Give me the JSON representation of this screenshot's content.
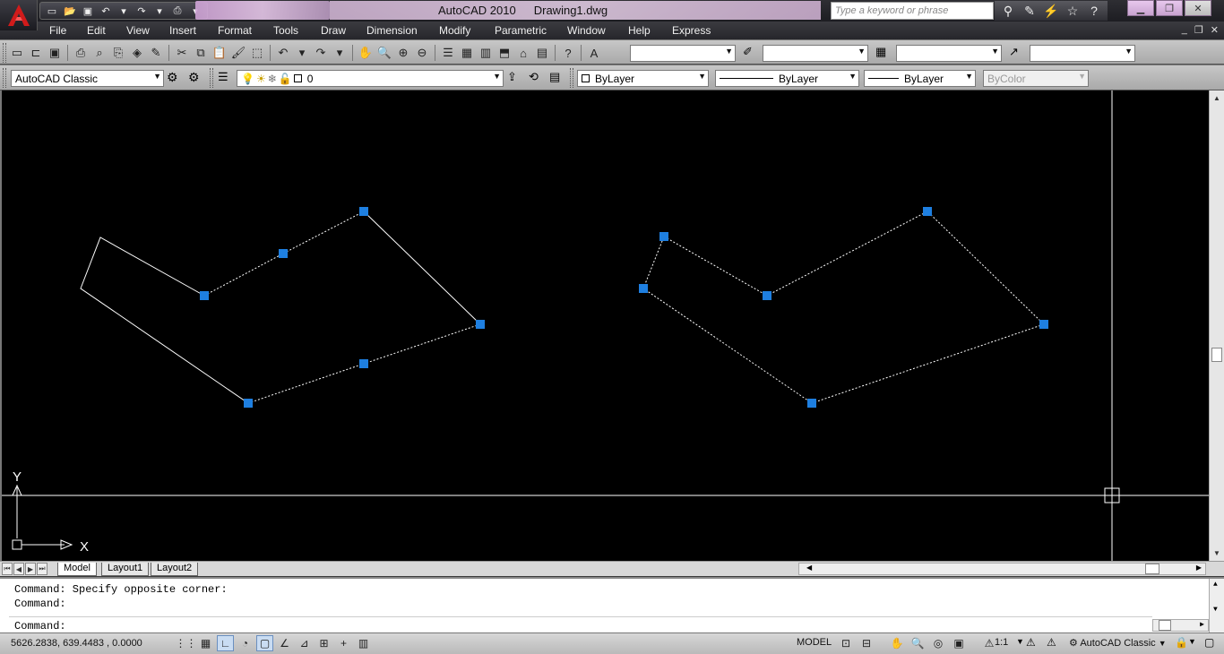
{
  "titlebar": {
    "app_name": "AutoCAD 2010",
    "file_name": "Drawing1.dwg",
    "search_placeholder": "Type a keyword or phrase",
    "app_icon": "autocad-logo-icon"
  },
  "menu": {
    "items": [
      "File",
      "Edit",
      "View",
      "Insert",
      "Format",
      "Tools",
      "Draw",
      "Dimension",
      "Modify",
      "Parametric",
      "Window",
      "Help",
      "Express"
    ]
  },
  "toolbar2": {
    "workspace": "AutoCAD Classic",
    "layer": "0",
    "color": "ByLayer",
    "linetype": "ByLayer",
    "lineweight": "ByLayer",
    "plotstyle": "ByColor"
  },
  "ucs": {
    "x_label": "X",
    "y_label": "Y"
  },
  "tabs": {
    "model": "Model",
    "layout1": "Layout1",
    "layout2": "Layout2"
  },
  "command": {
    "line1": "Command: Specify opposite corner:",
    "line2": "Command:",
    "prompt": "Command:"
  },
  "status": {
    "coordinates": "5626.2838, 639.4483 , 0.0000",
    "model": "MODEL",
    "annotation_scale": "1:1",
    "workspace": "AutoCAD Classic"
  },
  "colors": {
    "grip": "#1e7fe0",
    "canvas": "#000000",
    "line": "#ffffff"
  }
}
